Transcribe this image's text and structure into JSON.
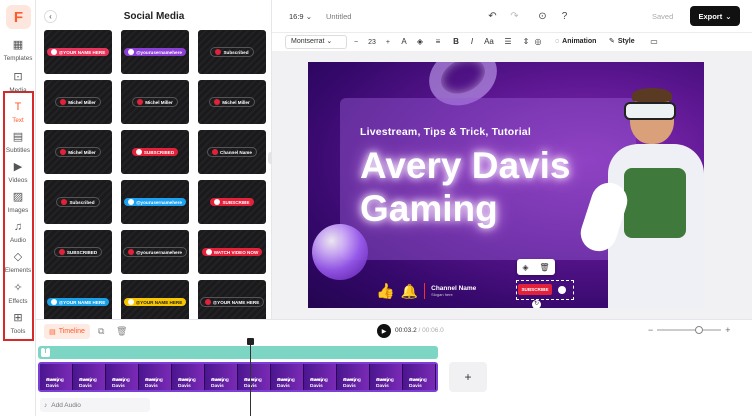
{
  "logo": {
    "letter": "F",
    "color": "#ff5a2a"
  },
  "rail": {
    "items": [
      {
        "label": "Templates",
        "icon": "templates-icon",
        "glyph": "▦"
      },
      {
        "label": "Media",
        "icon": "media-icon",
        "glyph": "⊡"
      },
      {
        "label": "Text",
        "icon": "text-icon",
        "glyph": "T"
      },
      {
        "label": "Subtitles",
        "icon": "subtitles-icon",
        "glyph": "▤"
      },
      {
        "label": "Videos",
        "icon": "videos-icon",
        "glyph": "▶"
      },
      {
        "label": "Images",
        "icon": "images-icon",
        "glyph": "▨"
      },
      {
        "label": "Audio",
        "icon": "audio-icon",
        "glyph": "♫"
      },
      {
        "label": "Elements",
        "icon": "elements-icon",
        "glyph": "◇"
      },
      {
        "label": "Effects",
        "icon": "effects-icon",
        "glyph": "✧"
      },
      {
        "label": "Tools",
        "icon": "tools-icon",
        "glyph": "⊞"
      }
    ]
  },
  "panel": {
    "title": "Social Media",
    "tiles": [
      {
        "text": "@YOUR NAME HERE",
        "color": "#e8345a",
        "icon": "tiktok-icon"
      },
      {
        "text": "@yourusernamehere",
        "color": "#8b3fd6",
        "icon": "instagram-icon"
      },
      {
        "text": "Subscribed",
        "color": "#ffffff",
        "icon": "bell-icon"
      },
      {
        "text": "Michel Miller",
        "color": "#ffffff",
        "icon": "instagram-icon"
      },
      {
        "text": "Michel Miller",
        "color": "#ffffff",
        "icon": "tiktok-icon"
      },
      {
        "text": "Michel Miller",
        "color": "#ffffff",
        "icon": "snapchat-icon"
      },
      {
        "text": "Michel Miller",
        "color": "#ffffff",
        "icon": "pinterest-icon"
      },
      {
        "text": "SUBSCRIBED",
        "color": "#e3213a",
        "icon": "youtube-icon"
      },
      {
        "text": "Channel Name",
        "color": "#ffffff",
        "icon": "like-icon"
      },
      {
        "text": "Subscribed",
        "color": "#ffffff",
        "icon": "bell-icon"
      },
      {
        "text": "@yourusernamehere",
        "color": "#1da1f2",
        "icon": "twitter-icon"
      },
      {
        "text": "SUBSCRIBE",
        "color": "#e3213a",
        "icon": "behance-icon"
      },
      {
        "text": "SUBSCRIBED",
        "color": "#ffffff",
        "icon": "youtube-icon"
      },
      {
        "text": "@yourusernamehere",
        "color": "#ffffff",
        "icon": "tiktok-icon"
      },
      {
        "text": "WATCH VIDEO NOW",
        "color": "#e3213a",
        "icon": "youtube-icon"
      },
      {
        "text": "@YOUR NAME HERE",
        "color": "#1aa0e6",
        "icon": "twitter-icon"
      },
      {
        "text": "@YOUR NAME HERE",
        "color": "#f7c600",
        "icon": "snapchat-icon"
      },
      {
        "text": "@YOUR NAME HERE",
        "color": "#ffffff",
        "icon": "instagram-icon"
      }
    ]
  },
  "topbar": {
    "ratio": "16:9",
    "title": "Untitled",
    "saved": "Saved",
    "export": "Export"
  },
  "format": {
    "font": "Montserrat",
    "size": "23",
    "animation": "Animation",
    "style": "Style"
  },
  "canvas": {
    "subtitle": "Livestream, Tips & Trick, Tutorial",
    "title_line1": "Avery Davis",
    "title_line2": "Gaming",
    "channel_name": "Channel Name",
    "channel_sub": "Slogan here",
    "subscribe": "SUBSCRIBE"
  },
  "timeline": {
    "tab": "Timeline",
    "current": "00:03.2",
    "total": "/ 00:06.0",
    "add_audio": "Add Audio",
    "frame_text": [
      "Avery Davis",
      "Gaming"
    ]
  }
}
